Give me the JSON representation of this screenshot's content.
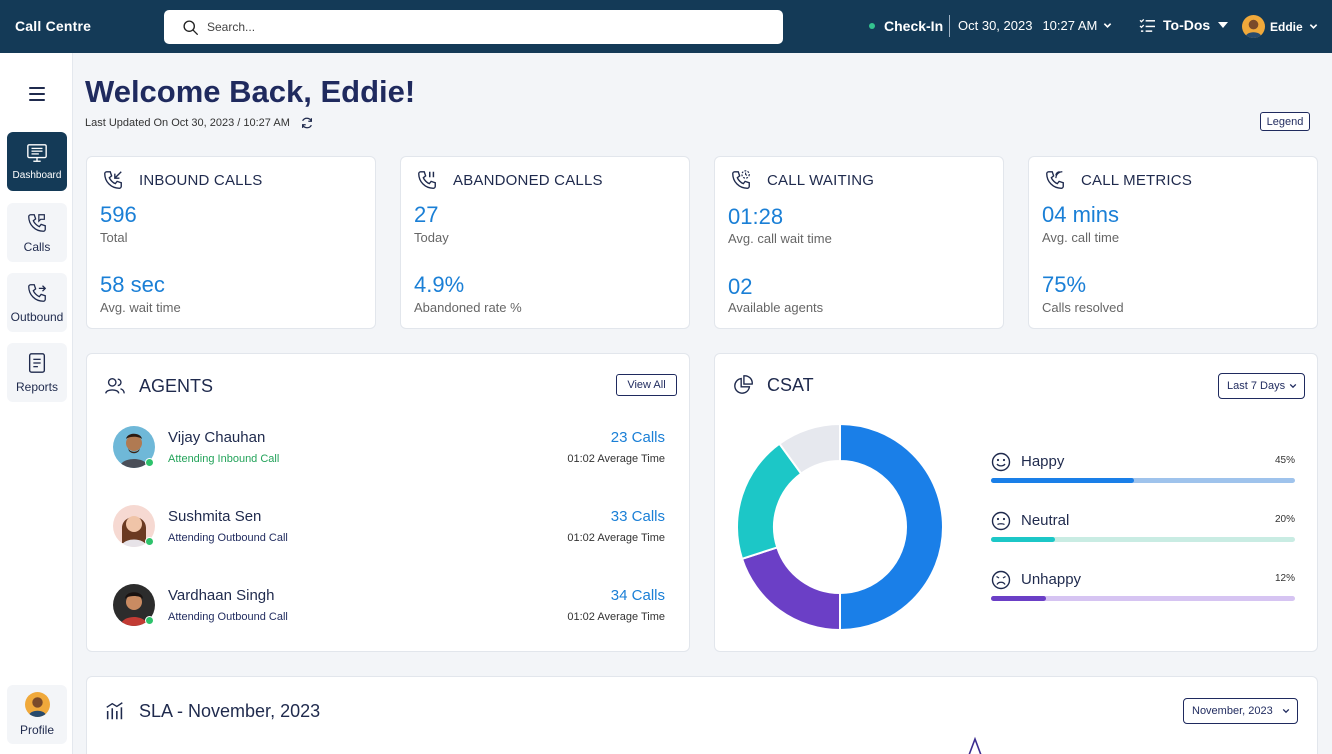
{
  "topbar": {
    "app_title": "Call Centre",
    "search_placeholder": "Search...",
    "checkin_label": "Check-In",
    "date": "Oct 30, 2023",
    "time": "10:27 AM",
    "todos_label": "To-Dos",
    "user_name": "Eddie"
  },
  "sidebar": {
    "items": [
      {
        "label": "Dashboard",
        "icon": "dashboard-icon"
      },
      {
        "label": "Calls",
        "icon": "calls-icon"
      },
      {
        "label": "Outbound",
        "icon": "outbound-icon"
      },
      {
        "label": "Reports",
        "icon": "reports-icon"
      }
    ],
    "profile_label": "Profile"
  },
  "header": {
    "welcome": "Welcome Back, Eddie!",
    "last_updated": "Last Updated On Oct 30, 2023 / 10:27 AM",
    "legend_label": "Legend"
  },
  "stats": [
    {
      "title": "INBOUND CALLS",
      "value1": "596",
      "label1": "Total",
      "value2": "58 sec",
      "label2": "Avg. wait time"
    },
    {
      "title": "ABANDONED CALLS",
      "value1": "27",
      "label1": "Today",
      "value2": "4.9%",
      "label2": "Abandoned rate %"
    },
    {
      "title": "CALL WAITING",
      "value1": "01:28",
      "label1": "Avg. call wait time",
      "value2": "02",
      "label2": "Available agents"
    },
    {
      "title": "CALL METRICS",
      "value1": "04 mins",
      "label1": "Avg. call time",
      "value2": "75%",
      "label2": "Calls resolved"
    }
  ],
  "agents": {
    "title": "AGENTS",
    "view_all": "View All",
    "list": [
      {
        "name": "Vijay Chauhan",
        "status": "Attending Inbound Call",
        "calls": "23 Calls",
        "avg": "01:02 Average Time",
        "status_color": "#23a35a"
      },
      {
        "name": "Sushmita Sen",
        "status": "Attending Outbound Call",
        "calls": "33 Calls",
        "avg": "01:02 Average Time",
        "status_color": "#1f2a5e"
      },
      {
        "name": "Vardhaan Singh",
        "status": "Attending Outbound Call",
        "calls": "34 Calls",
        "avg": "01:02 Average Time",
        "status_color": "#1f2a5e"
      }
    ]
  },
  "csat": {
    "title": "CSAT",
    "range": "Last 7 Days",
    "moods": [
      {
        "label": "Happy",
        "percent": "45%",
        "fill": 0.47,
        "color": "#1a7fe8",
        "track": "#9fc3ec"
      },
      {
        "label": "Neutral",
        "percent": "20%",
        "fill": 0.21,
        "color": "#1cc7c7",
        "track": "#c9ece3"
      },
      {
        "label": "Unhappy",
        "percent": "12%",
        "fill": 0.18,
        "color": "#6b3fc6",
        "track": "#d6c4f2"
      }
    ],
    "donut": [
      {
        "name": "blue",
        "value": 50,
        "color": "#1a7fe8"
      },
      {
        "name": "purple",
        "value": 20,
        "color": "#6b3fc6"
      },
      {
        "name": "teal",
        "value": 20,
        "color": "#1cc7c7"
      },
      {
        "name": "grey",
        "value": 10,
        "color": "#e6e8ee"
      }
    ]
  },
  "sla": {
    "title": "SLA - November, 2023",
    "month": "November, 2023"
  }
}
